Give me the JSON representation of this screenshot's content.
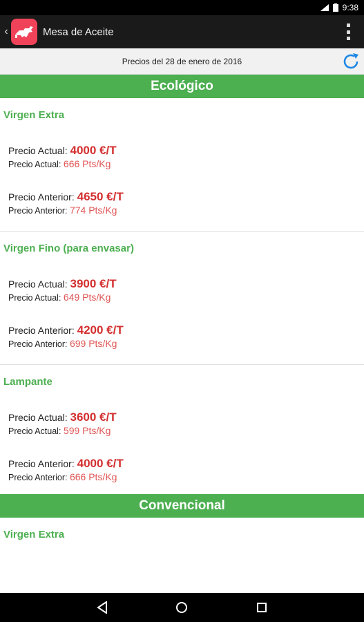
{
  "status": {
    "time": "9:38"
  },
  "app": {
    "title": "Mesa de Aceite"
  },
  "date_bar": {
    "text": "Precios del  28 de enero de 2016"
  },
  "labels": {
    "actual": "Precio Actual:",
    "anterior": "Precio Anterior:"
  },
  "sections": [
    {
      "title": "Ecológico",
      "products": [
        {
          "name": "Virgen Extra",
          "actual_t": "4000 €/T",
          "actual_kg": "666 Pts/Kg",
          "anterior_t": "4650 €/T",
          "anterior_kg": "774 Pts/Kg"
        },
        {
          "name": "Virgen Fino (para envasar)",
          "actual_t": "3900 €/T",
          "actual_kg": "649 Pts/Kg",
          "anterior_t": "4200 €/T",
          "anterior_kg": "699 Pts/Kg"
        },
        {
          "name": "Lampante",
          "actual_t": "3600 €/T",
          "actual_kg": "599 Pts/Kg",
          "anterior_t": "4000 €/T",
          "anterior_kg": "666 Pts/Kg"
        }
      ]
    },
    {
      "title": "Convencional",
      "products": [
        {
          "name": "Virgen Extra"
        }
      ]
    }
  ],
  "icons": {
    "back": "chevron-left-icon",
    "app": "app-logo-icon",
    "overflow": "overflow-menu-icon",
    "refresh": "refresh-icon",
    "nav_back": "nav-back-icon",
    "nav_home": "nav-home-icon",
    "nav_recents": "nav-recents-icon"
  },
  "colors": {
    "green": "#4caf50",
    "red": "#d32f2f",
    "action_bar": "#1a1a1a",
    "refresh_blue": "#1e88e5"
  }
}
